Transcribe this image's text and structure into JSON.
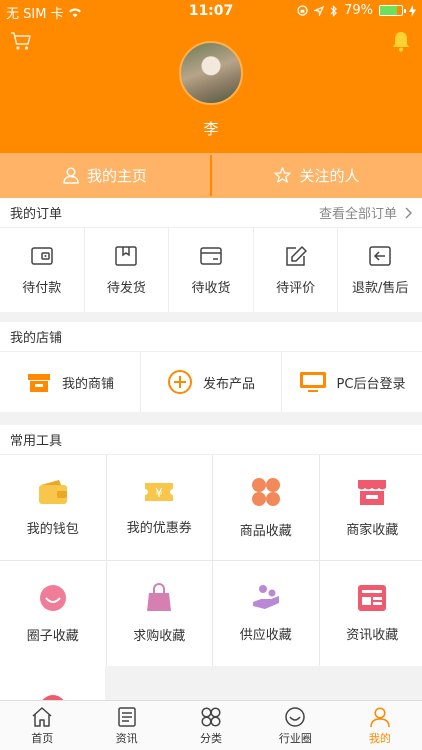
{
  "status": {
    "carrier": "无 SIM 卡",
    "time": "11:07",
    "battery": "79%",
    "battery_level": 0.79
  },
  "profile": {
    "username": "李"
  },
  "quick_tabs": {
    "home": "我的主页",
    "following": "关注的人"
  },
  "orders": {
    "title": "我的订单",
    "view_all": "查看全部订单",
    "items": [
      {
        "label": "待付款",
        "icon": "wallet-icon"
      },
      {
        "label": "待发货",
        "icon": "package-icon"
      },
      {
        "label": "待收货",
        "icon": "card-icon"
      },
      {
        "label": "待评价",
        "icon": "edit-icon"
      },
      {
        "label": "退款/售后",
        "icon": "return-icon"
      }
    ]
  },
  "shop": {
    "title": "我的店铺",
    "items": [
      {
        "label": "我的商铺",
        "icon": "store-icon"
      },
      {
        "label": "发布产品",
        "icon": "plus-circle-icon"
      },
      {
        "label": "PC后台登录",
        "icon": "monitor-icon"
      }
    ]
  },
  "tools": {
    "title": "常用工具",
    "items": [
      {
        "label": "我的钱包",
        "icon": "wallet-icon"
      },
      {
        "label": "我的优惠券",
        "icon": "coupon-icon"
      },
      {
        "label": "商品收藏",
        "icon": "grid-icon"
      },
      {
        "label": "商家收藏",
        "icon": "store-icon"
      },
      {
        "label": "圈子收藏",
        "icon": "smile-icon"
      },
      {
        "label": "求购收藏",
        "icon": "bag-icon"
      },
      {
        "label": "供应收藏",
        "icon": "hand-icon"
      },
      {
        "label": "资讯收藏",
        "icon": "news-icon"
      }
    ]
  },
  "nav": {
    "items": [
      {
        "label": "首页",
        "icon": "home-icon"
      },
      {
        "label": "资讯",
        "icon": "news-icon"
      },
      {
        "label": "分类",
        "icon": "category-icon"
      },
      {
        "label": "行业圈",
        "icon": "circle-icon"
      },
      {
        "label": "我的",
        "icon": "user-icon"
      }
    ],
    "active_index": 4
  },
  "colors": {
    "brand": "#ff8a00",
    "tab_bg": "#ffb366"
  }
}
